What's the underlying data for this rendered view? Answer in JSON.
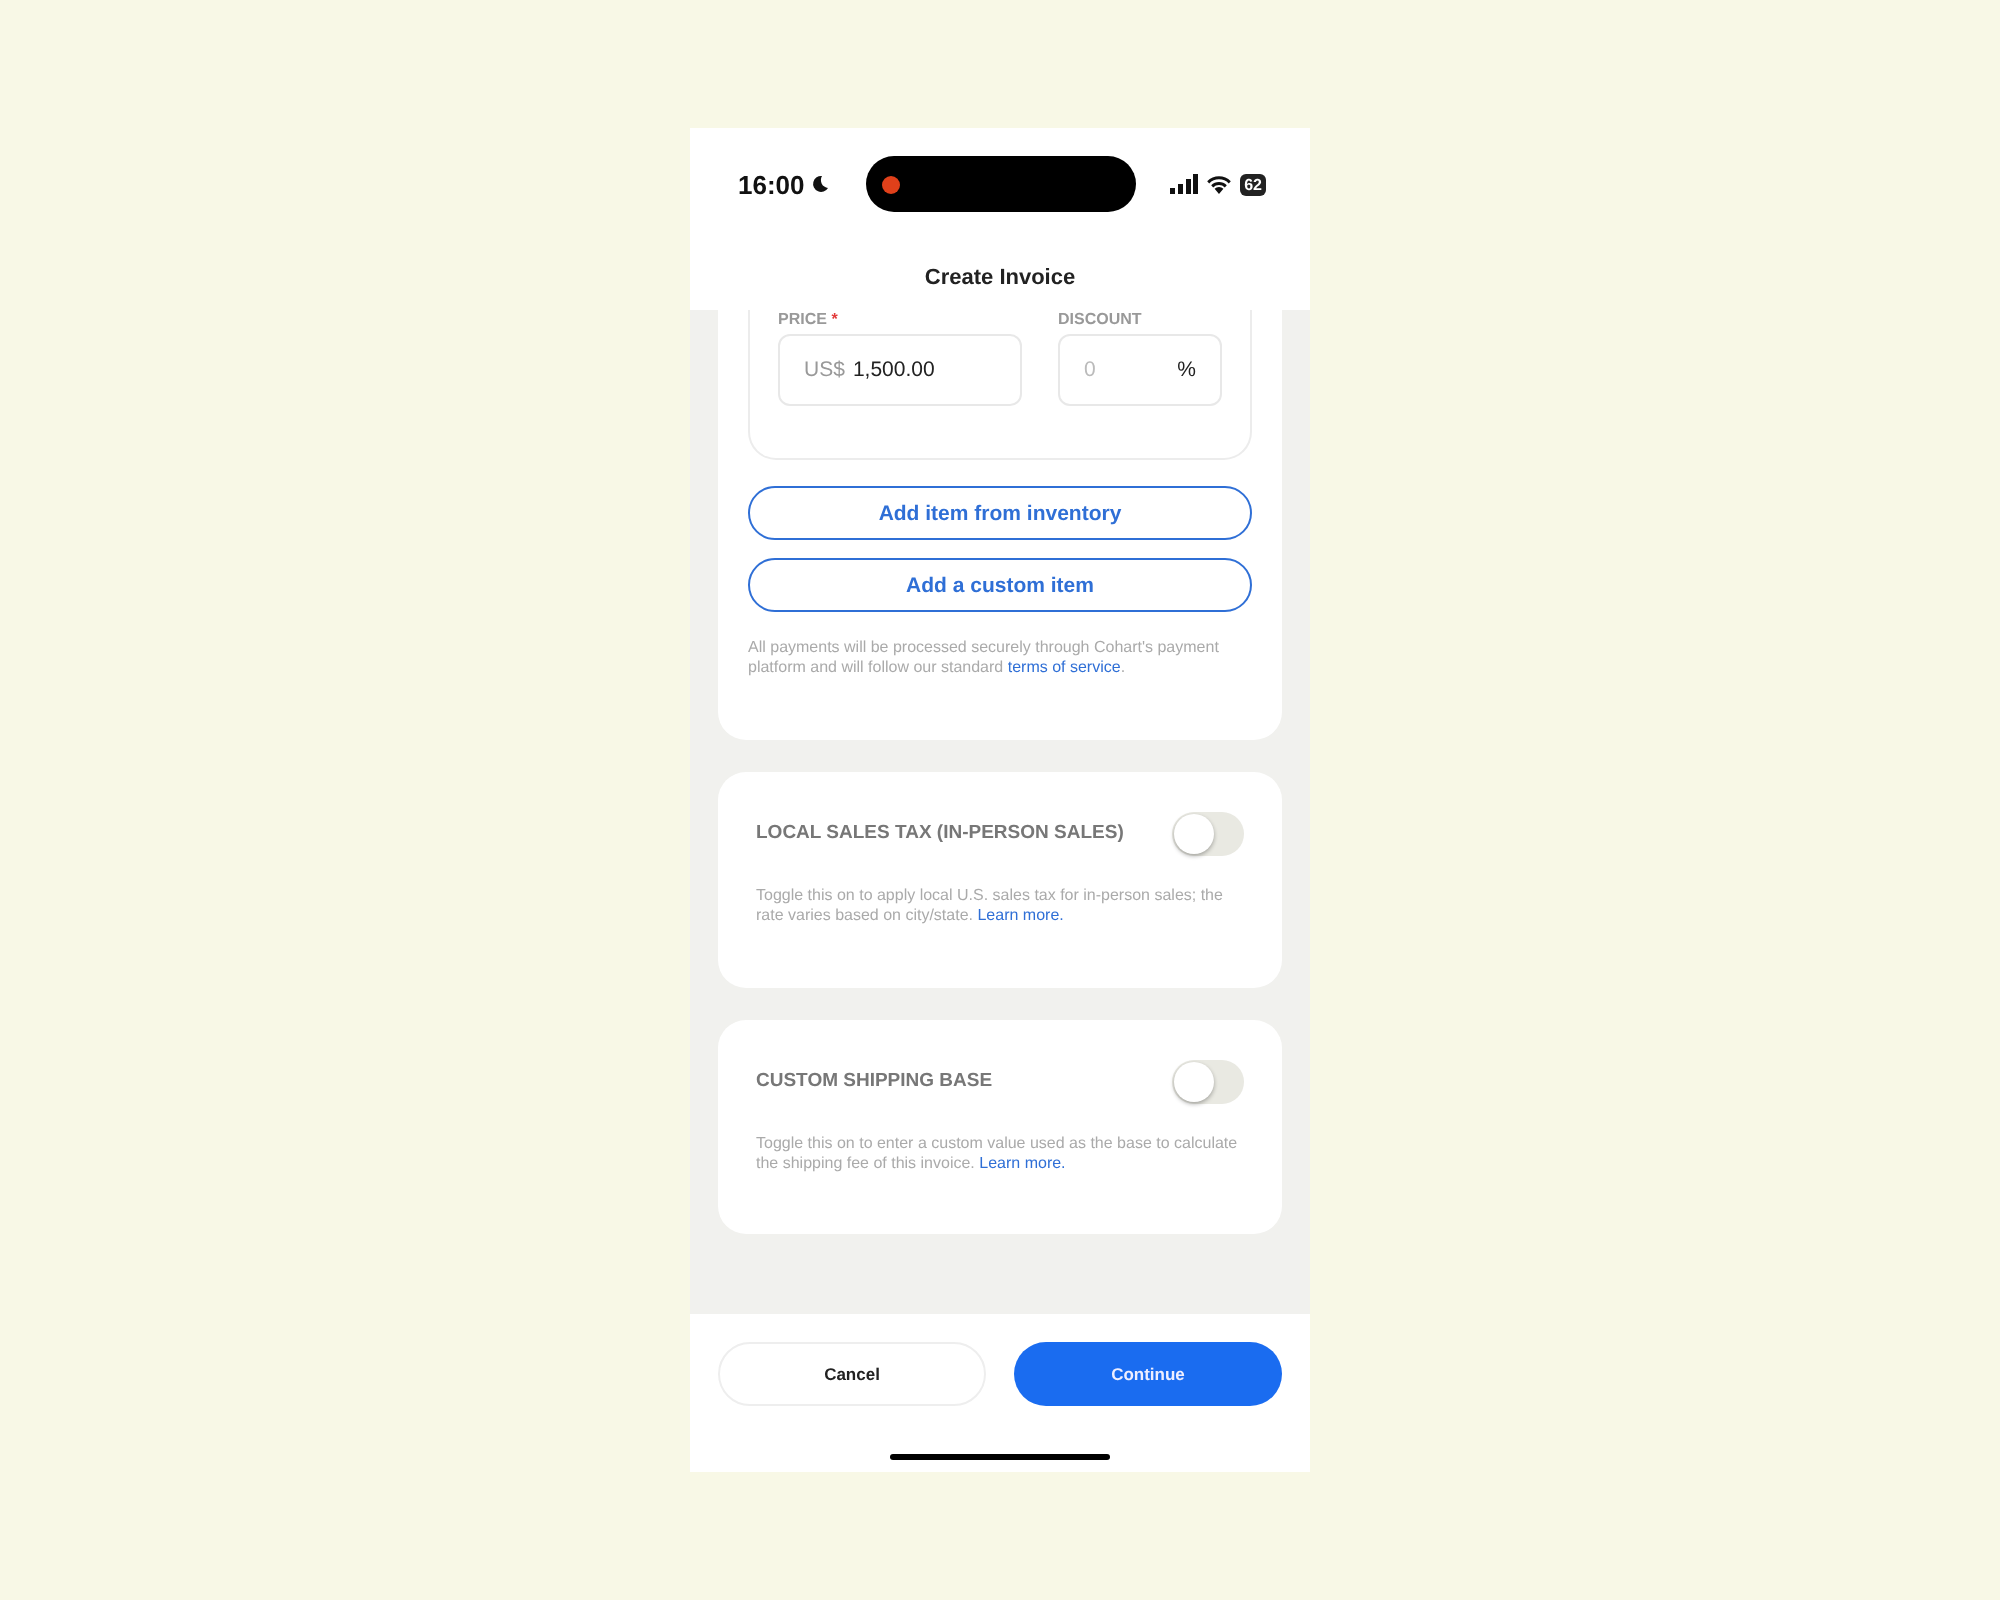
{
  "status_bar": {
    "time": "16:00",
    "battery": "62"
  },
  "header": {
    "title": "Create Invoice"
  },
  "item": {
    "price_label": "PRICE",
    "required_mark": "*",
    "currency": "US$",
    "price": "1,500.00",
    "discount_label": "DISCOUNT",
    "discount_placeholder": "0",
    "discount_unit": "%"
  },
  "buttons": [
    "Add item from inventory",
    "Add a custom item"
  ],
  "disclaimer": {
    "text": "All payments will be processed securely through Cohart's payment platform and will follow our standard",
    "link": "terms of service",
    "end": "."
  },
  "settings": [
    {
      "title": "LOCAL SALES TAX (IN-PERSON SALES)",
      "on": false,
      "description": "Toggle this on to apply local U.S. sales tax for in-person sales; the rate varies based on city/state.",
      "link": "Learn more."
    },
    {
      "title": "CUSTOM SHIPPING BASE",
      "on": false,
      "description": "Toggle this on to enter a custom value used as the base to calculate the shipping fee of this invoice.",
      "link": "Learn more."
    }
  ],
  "footer": {
    "cancel": "Cancel",
    "continue": "Continue"
  }
}
